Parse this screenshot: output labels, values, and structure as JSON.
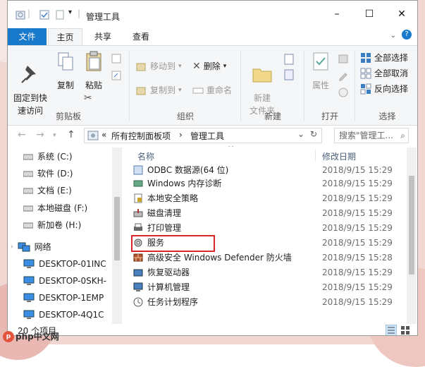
{
  "window": {
    "title": "管理工具",
    "controls": [
      "–",
      "☐",
      "✕"
    ]
  },
  "ribbon_tabs": [
    "文件",
    "主页",
    "共享",
    "查看"
  ],
  "ribbon": {
    "clipboard": {
      "pin_label": "固定到快\n速访问",
      "copy_label": "复制",
      "paste_label": "粘贴",
      "group_label": "剪贴板"
    },
    "organize": {
      "move_label": "移动到",
      "copy_to_label": "复制到",
      "delete_label": "删除",
      "rename_label": "重命名",
      "group_label": "组织"
    },
    "new": {
      "new_folder_label": "新建\n文件夹",
      "group_label": "新建"
    },
    "open": {
      "properties_label": "属性",
      "group_label": "打开"
    },
    "select": {
      "select_all_label": "全部选择",
      "select_none_label": "全部取消",
      "invert_label": "反向选择",
      "group_label": "选择"
    }
  },
  "address": {
    "crumb_overflow": "«",
    "crumb_1": "所有控制面板项",
    "crumb_sep": "›",
    "crumb_2": "管理工具",
    "search_placeholder": "搜索\"管理工...",
    "dropdown_glyph": "⌄",
    "refresh_glyph": "↻",
    "search_glyph": "⌕"
  },
  "nav_pane": {
    "drives": [
      {
        "label": "系统 (C:)",
        "icon": "drive-icon"
      },
      {
        "label": "软件 (D:)",
        "icon": "drive-icon"
      },
      {
        "label": "文档 (E:)",
        "icon": "drive-icon"
      },
      {
        "label": "本地磁盘 (F:)",
        "icon": "drive-icon"
      },
      {
        "label": "新加卷 (H:)",
        "icon": "drive-icon"
      }
    ],
    "network_label": "网络",
    "computers": [
      {
        "label": "DESKTOP-01INC"
      },
      {
        "label": "DESKTOP-0SKH-"
      },
      {
        "label": "DESKTOP-1EMP"
      },
      {
        "label": "DESKTOP-4Q1C"
      }
    ]
  },
  "file_list": {
    "col_name": "名称",
    "col_modified": "修改日期",
    "rows": [
      {
        "name": "ODBC 数据源(64 位)",
        "modified": "2018/9/15 15:29"
      },
      {
        "name": "Windows 内存诊断",
        "modified": "2018/9/15 15:29"
      },
      {
        "name": "本地安全策略",
        "modified": "2018/9/15 15:29"
      },
      {
        "name": "磁盘清理",
        "modified": "2018/9/15 15:29"
      },
      {
        "name": "打印管理",
        "modified": "2018/9/15 15:29"
      },
      {
        "name": "服务",
        "modified": "2018/9/15 15:29"
      },
      {
        "name": "高级安全 Windows Defender 防火墙",
        "modified": "2018/9/15 15:28"
      },
      {
        "name": "恢复驱动器",
        "modified": "2018/9/15 15:29"
      },
      {
        "name": "计算机管理",
        "modified": "2018/9/15 15:29"
      },
      {
        "name": "任务计划程序",
        "modified": "2018/9/15 15:29"
      }
    ],
    "highlighted_row": "服务",
    "highlight_color": "#d9252a"
  },
  "status_bar": {
    "item_count": "20 个项目"
  },
  "watermark": "php中文网",
  "colors": {
    "file_tab": "#1979ca",
    "ribbon_bg": "#f5f6f7"
  }
}
